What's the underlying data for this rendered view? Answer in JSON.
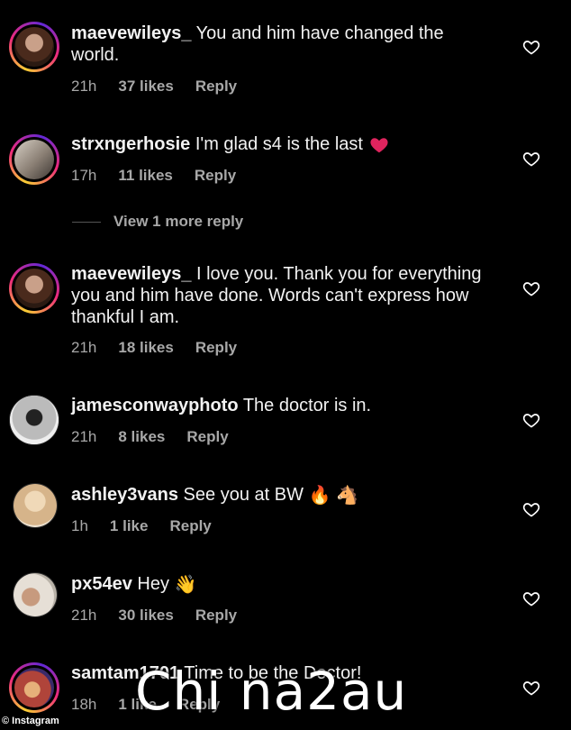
{
  "comments": [
    {
      "user": "maevewileys_",
      "text": "You and him have changed the world.",
      "time": "21h",
      "likes": "37 likes",
      "reply": "Reply"
    },
    {
      "user": "strxngerhosie",
      "text": "I'm glad s4 is the last",
      "time": "17h",
      "likes": "11 likes",
      "reply": "Reply"
    },
    {
      "user": "maevewileys_",
      "text": "I love you. Thank you for everything you and him have done. Words can't express how thankful I am.",
      "time": "21h",
      "likes": "18 likes",
      "reply": "Reply"
    },
    {
      "user": "jamesconwayphoto",
      "text": "The doctor is in.",
      "time": "21h",
      "likes": "8 likes",
      "reply": "Reply"
    },
    {
      "user": "ashley3vans",
      "text": "See you at BW",
      "time": "1h",
      "likes": "1 like",
      "reply": "Reply"
    },
    {
      "user": "px54ev",
      "text": "Hey",
      "time": "21h",
      "likes": "30 likes",
      "reply": "Reply"
    },
    {
      "user": "samtam1701",
      "text": "Time to be the Doctor!",
      "time": "18h",
      "likes": "1 like",
      "reply": "Reply"
    }
  ],
  "view_more": "View 1 more reply",
  "watermark": "Chi na2au",
  "credit": "© Instagram",
  "colors": {
    "background": "#000000",
    "meta": "#a8a8a8",
    "heart_emoji": "#e0245e"
  }
}
